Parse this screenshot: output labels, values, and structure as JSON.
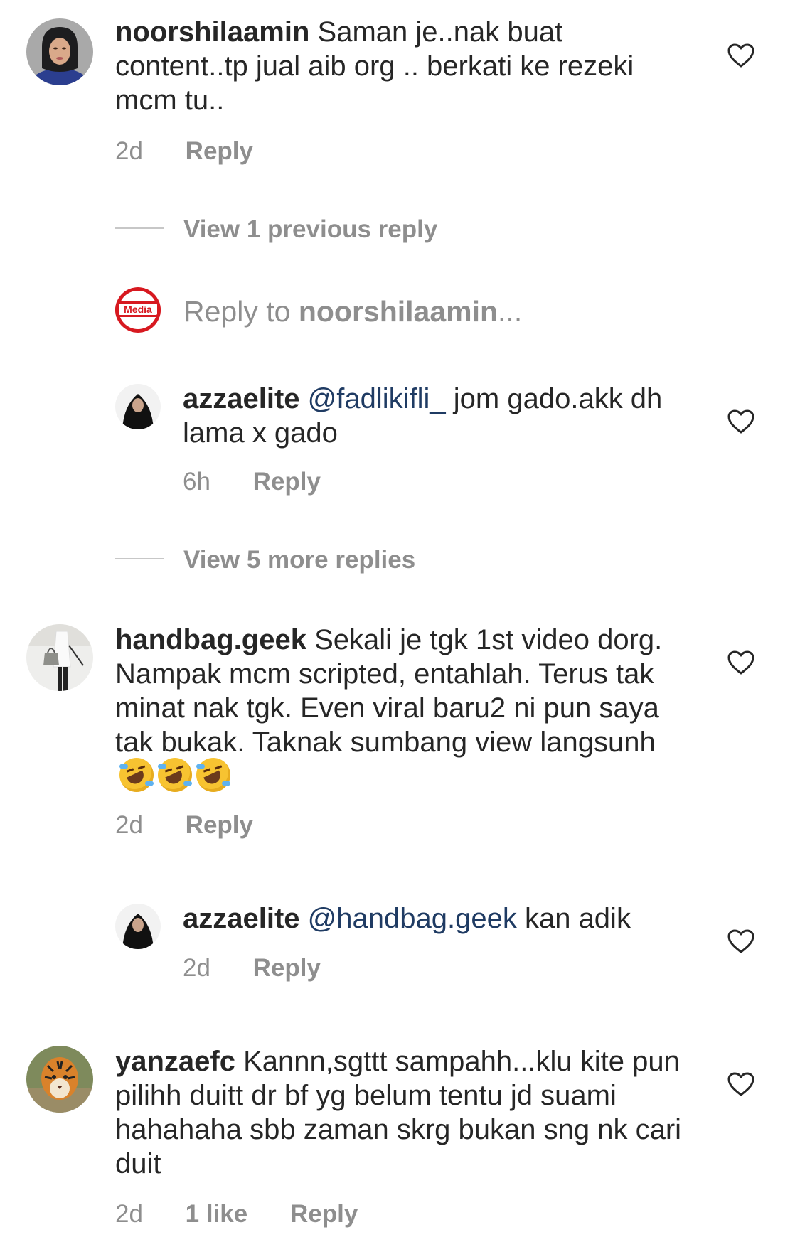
{
  "comments": [
    {
      "username": "noorshilaamin",
      "text": "Saman je..nak buat content..tp jual aib org .. berkati ke rezeki mcm tu..",
      "time": "2d",
      "reply_label": "Reply"
    },
    {
      "username": "handbag.geek",
      "text": "Sekali je tgk 1st video dorg. Nampak mcm scripted, entahlah. Terus tak minat nak tgk. Even viral baru2 ni pun saya tak bukak. Taknak sumbang view langsunh",
      "emoji": "🤣🤣🤣",
      "time": "2d",
      "reply_label": "Reply"
    },
    {
      "username": "yanzaefc",
      "text": "Kannn,sgttt sampahh...klu kite pun pilihh duitt dr bf yg belum tentu jd suami hahahaha sbb zaman skrg bukan sng nk cari duit",
      "time": "2d",
      "likes": "1 like",
      "reply_label": "Reply"
    }
  ],
  "replies": [
    {
      "username": "azzaelite",
      "mention": "@fadlikifli_",
      "text": " jom gado.akk dh lama x gado",
      "time": "6h",
      "reply_label": "Reply"
    },
    {
      "username": "azzaelite",
      "mention": "@handbag.geek",
      "text": " kan adik",
      "time": "2d",
      "reply_label": "Reply"
    }
  ],
  "view_previous": "View 1 previous reply",
  "view_more": "View 5 more replies",
  "reply_box": {
    "prefix": "Reply to ",
    "target": "noorshilaamin",
    "suffix": "...",
    "avatar_logo": "Media"
  },
  "colors": {
    "text": "#262626",
    "muted": "#8e8e8e",
    "mention": "#1f3b63",
    "logo_red": "#d71920"
  },
  "icons": {
    "like": "heart-outline-icon"
  }
}
